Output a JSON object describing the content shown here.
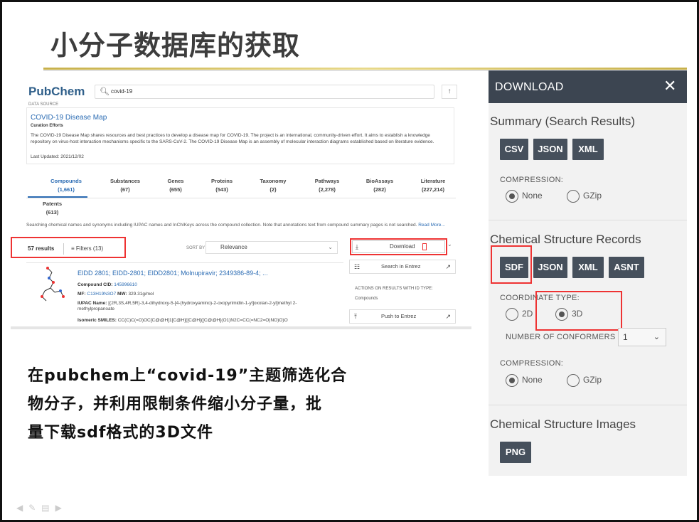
{
  "slide": {
    "title": "小分子数据库的获取",
    "caption_lines": [
      "在pubchem上“covid-19”主题筛选化合",
      "物分子，并利用限制条件缩小分子量，批",
      "量下载sdf格式的3D文件"
    ]
  },
  "pubchem": {
    "logo": "PubChem",
    "search_query": "covid-19",
    "data_source_label": "DATA SOURCE",
    "card": {
      "title": "COVID-19 Disease Map",
      "subtitle": "Curation Efforts",
      "description": "The COVID-19 Disease Map shares resources and best practices to develop a disease map for COVID-19. The project is an international, community-driven effort. It aims to establish a knowledge repository on virus-host interaction mechanisms specific to the SARS-CoV-2. The COVID-19 Disease Map is an assembly of molecular interaction diagrams established based on literature evidence.",
      "updated": "Last Updated: 2021/12/02"
    },
    "tabs": [
      {
        "label": "Compounds",
        "count": "(1,661)"
      },
      {
        "label": "Substances",
        "count": "(67)"
      },
      {
        "label": "Genes",
        "count": "(655)"
      },
      {
        "label": "Proteins",
        "count": "(543)"
      },
      {
        "label": "Taxonomy",
        "count": "(2)"
      },
      {
        "label": "Pathways",
        "count": "(2,278)"
      },
      {
        "label": "BioAssays",
        "count": "(282)"
      },
      {
        "label": "Literature",
        "count": "(227,214)"
      }
    ],
    "patents": {
      "label": "Patents",
      "count": "(613)"
    },
    "note": "Searching chemical names and synonyms including IUPAC names and InChIKeys across the compound collection. Note that annotations text from compound summary pages is not searched.",
    "note_more": "Read More...",
    "results_count": "57 results",
    "filters_label": "Filters (13)",
    "sort_by_label": "SORT BY",
    "sort_value": "Relevance",
    "download_label": "Download",
    "hit": {
      "title": "EIDD 2801; EIDD-2801; EIDD2801; Molnupiravir; 2349386-89-4; ...",
      "cid_label": "Compound CID:",
      "cid_value": "145996610",
      "mf_label": "MF:",
      "mf_value": "C13H19N3O7",
      "mw_label": "MW:",
      "mw_value": "329.31g/mol",
      "iupac_label": "IUPAC Name:",
      "iupac_value": "[(2R,3S,4R,5R)-3,4-dihydroxy-5-[4-(hydroxyamino)-2-oxopyrimidin-1-yl]oxolan-2-yl]methyl 2-methylpropanoate",
      "smiles_label": "Isomeric SMILES:",
      "smiles_value": "CC(C)C(=O)OC[C@@H]1[C@H]([C@H]([C@@H](O1)N2C=CC(=NC2=O)NO)O)O"
    },
    "side": {
      "search_entrez": "Search in Entrez",
      "actions_header": "ACTIONS ON RESULTS WITH ID TYPE:",
      "id_type": "Compounds",
      "push_entrez": "Push to Entrez"
    }
  },
  "download_panel": {
    "header": "DOWNLOAD",
    "summary_title": "Summary (Search Results)",
    "summary_formats": [
      "CSV",
      "JSON",
      "XML"
    ],
    "compression_label": "COMPRESSION:",
    "compression_none": "None",
    "compression_gzip": "GZip",
    "structure_title": "Chemical Structure Records",
    "structure_formats": [
      "SDF",
      "JSON",
      "XML",
      "ASNT"
    ],
    "coordinate_label": "COORDINATE TYPE:",
    "coord_2d": "2D",
    "coord_3d": "3D",
    "conformers_label": "NUMBER OF CONFORMERS",
    "conformers_value": "1",
    "compression2_label": "COMPRESSION:",
    "compression2_none": "None",
    "compression2_gzip": "GZip",
    "images_title": "Chemical Structure Images",
    "images_formats": [
      "PNG"
    ]
  },
  "colors": {
    "panel_header": "#3c4551",
    "format_button": "#46505c",
    "highlight": "#ee3333",
    "link": "#2a6bb3"
  }
}
